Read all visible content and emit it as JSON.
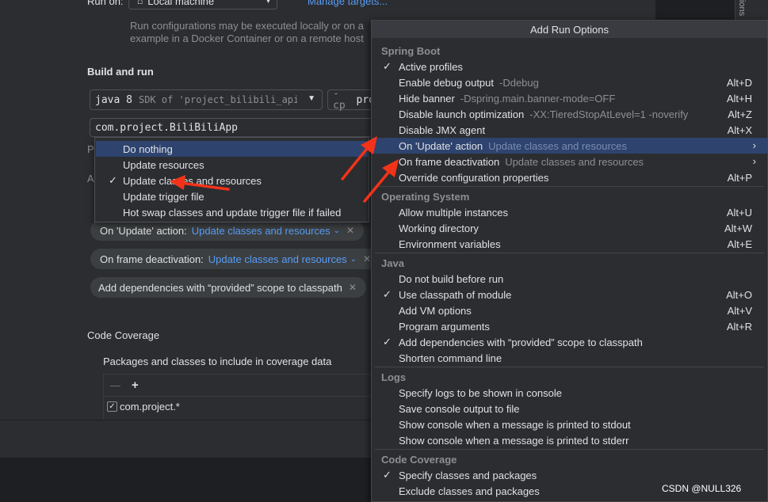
{
  "dialog": {
    "run_on_label": "Run on:",
    "run_on_value": "Local machine",
    "manage_targets": "Manage targets...",
    "run_on_help_1": "Run configurations may be executed locally or on a",
    "run_on_help_2": "example in a Docker Container or on a remote host",
    "build_and_run": "Build and run",
    "jdk_value": "java 8",
    "jdk_hint": "SDK of 'project_bilibili_api' m",
    "cp_prefix": "-cp",
    "cp_value": "pro",
    "main_class": "com.project.BiliBiliApp",
    "truncated_p": "P",
    "truncated_a": "A",
    "chips": [
      {
        "label": "On 'Update' action:",
        "value": "Update classes and resources"
      },
      {
        "label": "On frame deactivation:",
        "value": "Update classes and resources"
      },
      {
        "label": "Add dependencies with “provided” scope to classpath",
        "value": ""
      }
    ],
    "chip_dropdown_icon": "chevron-down-icon",
    "chip_close_icon": "close-icon",
    "code_coverage": "Code Coverage",
    "packages_label": "Packages and classes to include in coverage data",
    "coverage_minus": "—",
    "coverage_add": "+",
    "coverage_entry": "com.project.*",
    "edge_text": "ions"
  },
  "popup": {
    "items": [
      {
        "label": "Do nothing",
        "checked": false,
        "selected": true
      },
      {
        "label": "Update resources",
        "checked": false,
        "selected": false
      },
      {
        "label": "Update classes and resources",
        "checked": true,
        "selected": false
      },
      {
        "label": "Update trigger file",
        "checked": false,
        "selected": false
      },
      {
        "label": "Hot swap classes and update trigger file if failed",
        "checked": false,
        "selected": false
      }
    ]
  },
  "menu": {
    "title": "Add Run Options",
    "rows": [
      {
        "type": "header",
        "label": "Spring Boot"
      },
      {
        "type": "item",
        "label": "Active profiles",
        "checked": true
      },
      {
        "type": "item",
        "label": "Enable debug output",
        "hint": "-Ddebug",
        "shortcut": "Alt+D"
      },
      {
        "type": "item",
        "label": "Hide banner",
        "hint": "-Dspring.main.banner-mode=OFF",
        "shortcut": "Alt+H"
      },
      {
        "type": "item",
        "label": "Disable launch optimization",
        "hint": "-XX:TieredStopAtLevel=1 -noverify",
        "shortcut": "Alt+Z"
      },
      {
        "type": "item",
        "label": "Disable JMX agent",
        "shortcut": "Alt+X"
      },
      {
        "type": "item",
        "label": "On 'Update' action",
        "hint": "Update classes and resources",
        "submenu": true,
        "selected": true
      },
      {
        "type": "item",
        "label": "On frame deactivation",
        "hint": "Update classes and resources",
        "submenu": true
      },
      {
        "type": "item",
        "label": "Override configuration properties",
        "shortcut": "Alt+P"
      },
      {
        "type": "header",
        "label": "Operating System"
      },
      {
        "type": "item",
        "label": "Allow multiple instances",
        "shortcut": "Alt+U"
      },
      {
        "type": "item",
        "label": "Working directory",
        "shortcut": "Alt+W"
      },
      {
        "type": "item",
        "label": "Environment variables",
        "shortcut": "Alt+E"
      },
      {
        "type": "header",
        "label": "Java"
      },
      {
        "type": "item",
        "label": "Do not build before run"
      },
      {
        "type": "item",
        "label": "Use classpath of module",
        "checked": true,
        "shortcut": "Alt+O"
      },
      {
        "type": "item",
        "label": "Add VM options",
        "shortcut": "Alt+V"
      },
      {
        "type": "item",
        "label": "Program arguments",
        "shortcut": "Alt+R"
      },
      {
        "type": "item",
        "label": "Add dependencies with “provided” scope to classpath",
        "checked": true
      },
      {
        "type": "item",
        "label": "Shorten command line"
      },
      {
        "type": "header",
        "label": "Logs"
      },
      {
        "type": "item",
        "label": "Specify logs to be shown in console"
      },
      {
        "type": "item",
        "label": "Save console output to file"
      },
      {
        "type": "item",
        "label": "Show console when a message is printed to stdout"
      },
      {
        "type": "item",
        "label": "Show console when a message is printed to stderr"
      },
      {
        "type": "header",
        "label": "Code Coverage"
      },
      {
        "type": "item",
        "label": "Specify classes and packages",
        "checked": true
      },
      {
        "type": "item",
        "label": "Exclude classes and packages"
      }
    ]
  },
  "watermark": "CSDN @NULL326",
  "colors": {
    "selection": "#2e436e",
    "link": "#589df6",
    "annotation": "#f2331a"
  }
}
